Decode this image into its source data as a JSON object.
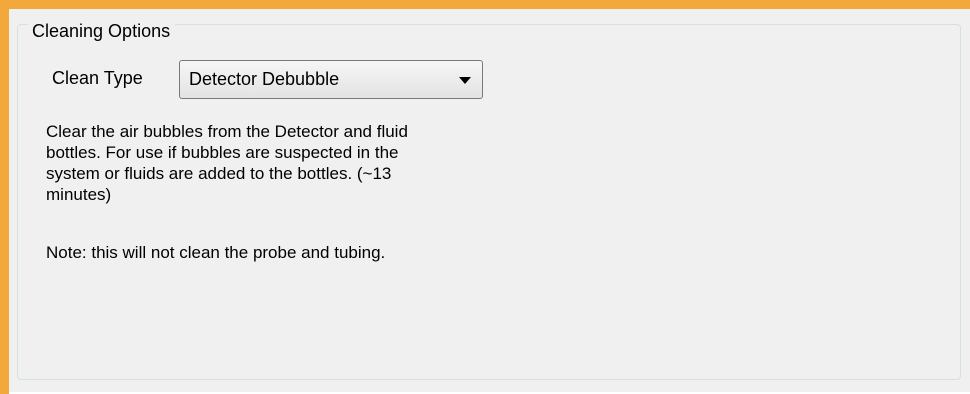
{
  "frame": {
    "accent_color": "#f3a83b",
    "panel_color": "#f0f0f0"
  },
  "group": {
    "title": "Cleaning Options"
  },
  "clean_type": {
    "label": "Clean Type",
    "selected": "Detector Debubble",
    "arrow_icon": "chevron-down-icon"
  },
  "description": {
    "lines": [
      "Clear the air bubbles from the Detector and fluid",
      "bottles. For use if bubbles are suspected in the",
      "system or fluids are added to the bottles. (~13",
      "minutes)"
    ]
  },
  "note": "Note: this will not clean the probe and tubing."
}
